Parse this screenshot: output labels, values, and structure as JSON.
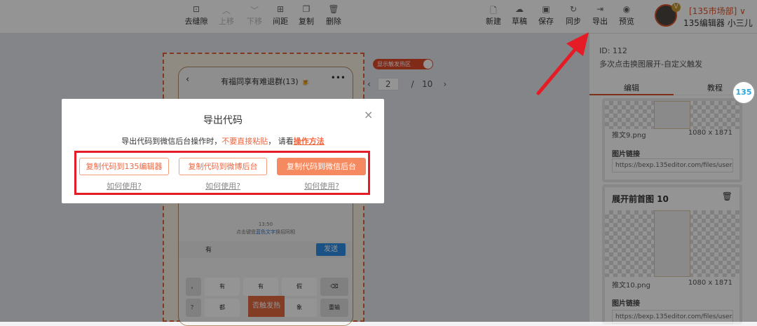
{
  "toolbar_left": [
    {
      "label": "去缝隙",
      "icon": "gap-icon",
      "enabled": true
    },
    {
      "label": "上移",
      "icon": "chevron-up-icon",
      "enabled": false
    },
    {
      "label": "下移",
      "icon": "chevron-down-icon",
      "enabled": false
    },
    {
      "label": "间距",
      "icon": "spacing-icon",
      "enabled": true
    },
    {
      "label": "复制",
      "icon": "copy-icon",
      "enabled": true
    },
    {
      "label": "删除",
      "icon": "trash-icon",
      "enabled": true
    }
  ],
  "toolbar_right": [
    {
      "label": "新建",
      "icon": "new-file-icon"
    },
    {
      "label": "草稿",
      "icon": "cloud-icon"
    },
    {
      "label": "保存",
      "icon": "save-icon"
    },
    {
      "label": "同步",
      "icon": "sync-icon"
    },
    {
      "label": "导出",
      "icon": "export-icon"
    },
    {
      "label": "预览",
      "icon": "eye-icon"
    }
  ],
  "user": {
    "badge": "V",
    "dept": "[135市场部] ∨",
    "name": "135编辑器 小三儿"
  },
  "phone": {
    "chat_title": "有福同享有难退群(13) 🍺",
    "back": "‹",
    "more": "•••",
    "time": "13:50",
    "hint_pre": "点击键盘",
    "hint_blue": "蓝色文字",
    "hint_post": "换招同相",
    "input_text": "有",
    "send": "发送",
    "keys": [
      "有",
      "有",
      "假",
      "⌫",
      "都",
      "",
      "象",
      "重输"
    ],
    "hot_label": "否触发热",
    "side_keys": [
      "，",
      "？",
      "。"
    ]
  },
  "hotspot_toggle": {
    "label": "显示触发热区",
    "on": true
  },
  "pager": {
    "prev": "‹",
    "current": "2",
    "separator": "/",
    "total": "10",
    "next": "›"
  },
  "right_panel": {
    "id": "ID: 112",
    "desc": "多次点击换图展开-自定义触发",
    "tabs": [
      "编辑",
      "教程"
    ],
    "logo": "135",
    "cards": [
      {
        "title": "",
        "file": "推文9.png",
        "size": "1080 x 1871",
        "link_label": "图片链接",
        "url": "https://bexp.135editor.com/files/users/"
      },
      {
        "title": "展开前首图 10",
        "file": "推文10.png",
        "size": "1080 x 1871",
        "link_label": "图片链接",
        "url": "https://bexp.135editor.com/files/users/"
      }
    ]
  },
  "modal": {
    "title": "导出代码",
    "close": "×",
    "desc_pre": "导出代码到微信后台操作时，",
    "desc_warn": "不要直接粘贴",
    "desc_mid": "，  请看",
    "desc_link": "操作方法",
    "buttons": [
      {
        "label": "复制代码到135编辑器",
        "help": "如何使用?"
      },
      {
        "label": "复制代码到微博后台",
        "help": "如何使用?"
      },
      {
        "label": "复制代码到微信后台",
        "help": "如何使用?"
      }
    ]
  },
  "colors": {
    "accent": "#f0653d",
    "annotation": "#e51b25"
  }
}
